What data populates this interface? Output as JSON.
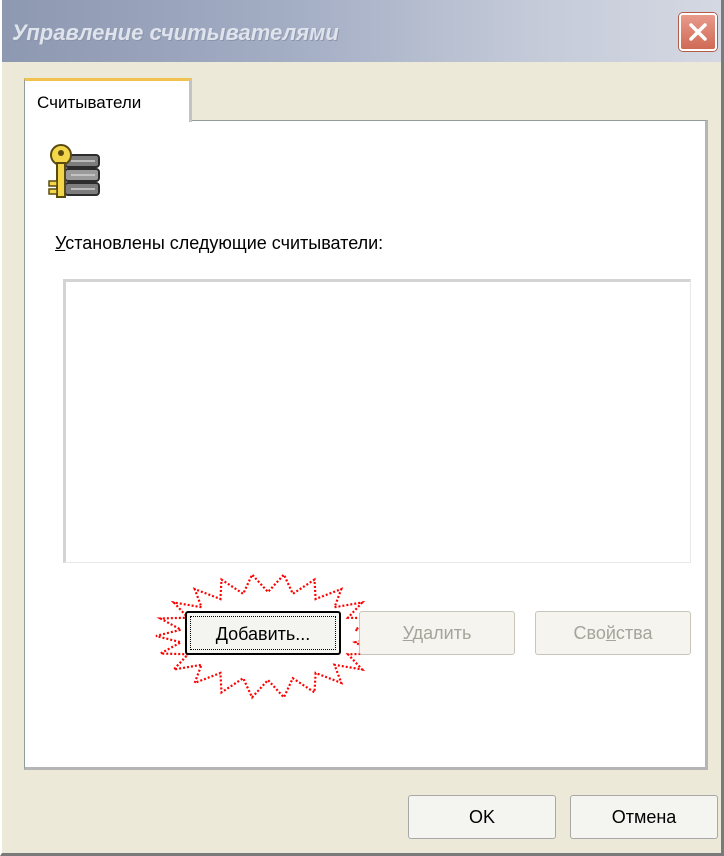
{
  "window": {
    "title": "Управление считывателями"
  },
  "tabs": [
    {
      "label": "Считыватели",
      "selected": true
    }
  ],
  "panel": {
    "icon": "key-server-icon",
    "list_label_accel": "У",
    "list_label_rest": "становлены следующие считыватели:",
    "list_items": []
  },
  "buttons": {
    "add_accel": "Д",
    "add_rest": "обавить...",
    "delete_pre": "",
    "delete_accel": "У",
    "delete_rest": "далить",
    "props_pre": "Сво",
    "props_accel": "й",
    "props_rest": "ства",
    "ok": "OK",
    "cancel": "Отмена"
  },
  "annotation": {
    "highlight_color": "#ff0000"
  }
}
